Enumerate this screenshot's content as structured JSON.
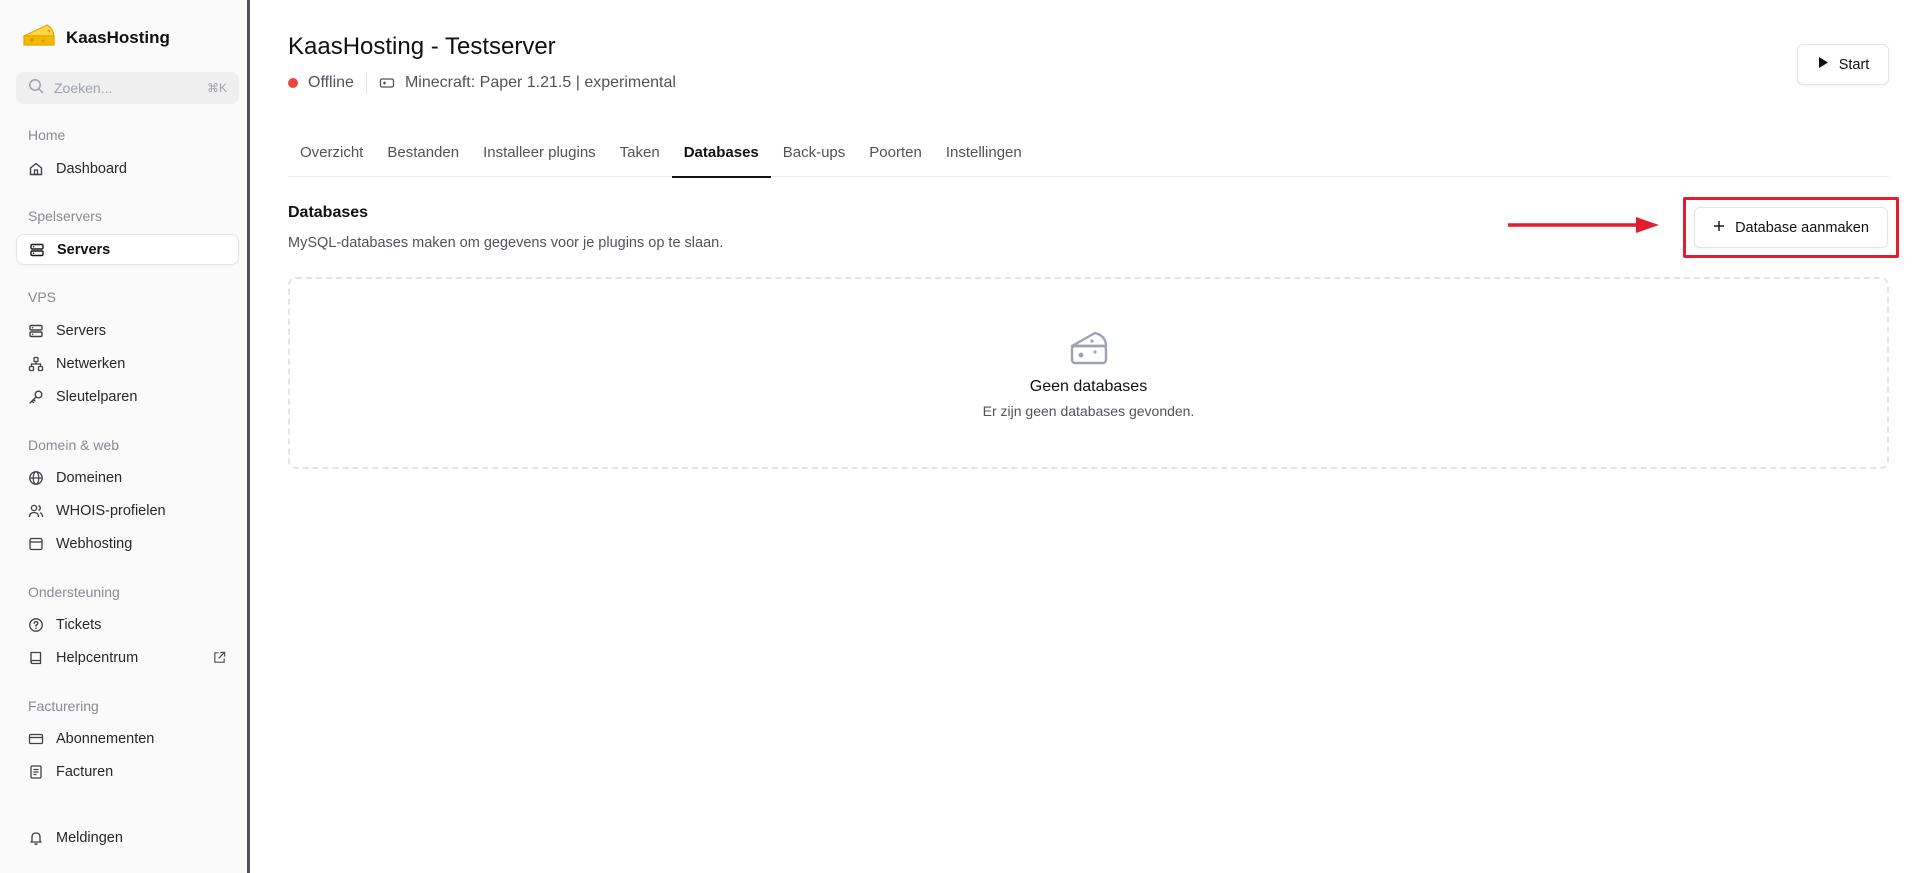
{
  "brand": {
    "name": "KaasHosting"
  },
  "search": {
    "placeholder": "Zoeken...",
    "shortcut": "⌘K"
  },
  "sidebar": {
    "groups": {
      "home": "Home",
      "game": "Spelservers",
      "vps": "VPS",
      "domain": "Domein & web",
      "support": "Ondersteuning",
      "billing": "Facturering"
    },
    "items": {
      "dashboard": "Dashboard",
      "game_servers": "Servers",
      "vps_servers": "Servers",
      "networks": "Netwerken",
      "keypairs": "Sleutelparen",
      "domains": "Domeinen",
      "whois": "WHOIS-profielen",
      "webhosting": "Webhosting",
      "tickets": "Tickets",
      "helpcenter": "Helpcentrum",
      "subscriptions": "Abonnementen",
      "invoices": "Facturen",
      "notifications": "Meldingen"
    }
  },
  "server": {
    "title": "KaasHosting - Testserver",
    "status": "Offline",
    "software": "Minecraft: Paper 1.21.5 | experimental",
    "start_label": "Start"
  },
  "tabs": [
    "Overzicht",
    "Bestanden",
    "Installeer plugins",
    "Taken",
    "Databases",
    "Back-ups",
    "Poorten",
    "Instellingen"
  ],
  "databases": {
    "title": "Databases",
    "description": "MySQL-databases maken om gegevens voor je plugins op te slaan.",
    "create_label": "Database aanmaken",
    "empty_title": "Geen databases",
    "empty_desc": "Er zijn geen databases gevonden."
  },
  "colors": {
    "status_offline": "#ef4444",
    "highlight": "#e11d2e",
    "brand_cheese": "#f5b800"
  }
}
